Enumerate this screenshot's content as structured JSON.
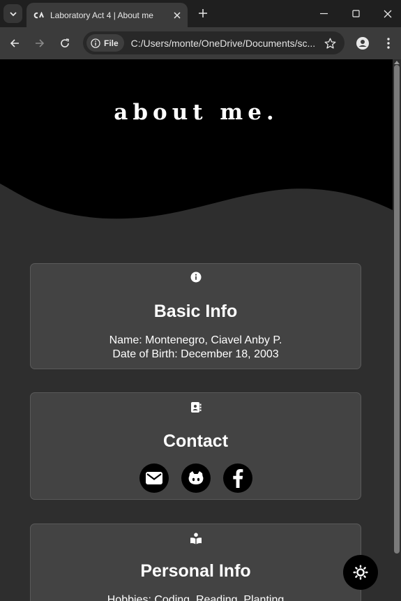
{
  "browser": {
    "tab": {
      "title": "Laboratory Act 4 | About me",
      "favicon": "ca-logo-icon"
    },
    "omnibox": {
      "chip_label": "File",
      "url": "C:/Users/monte/OneDrive/Documents/sc..."
    }
  },
  "page": {
    "hero_title": "about me.",
    "basic_info": {
      "icon": "info-icon",
      "title": "Basic Info",
      "name_line": "Name: Montenegro, Ciavel Anby P.",
      "dob_line": "Date of Birth: December 18, 2003"
    },
    "contact": {
      "icon": "address-book-icon",
      "title": "Contact",
      "links": [
        "email-icon",
        "github-icon",
        "facebook-icon"
      ]
    },
    "personal_info": {
      "icon": "reading-person-icon",
      "title": "Personal Info",
      "hobbies_line": "Hobbies: Coding, Reading, Planting"
    },
    "theme_toggle_icon": "sun-icon"
  },
  "colors": {
    "page_bg": "#2e2e2e",
    "hero_bg": "#000000",
    "card_bg": "#434343",
    "card_border": "#5a5a5a"
  }
}
